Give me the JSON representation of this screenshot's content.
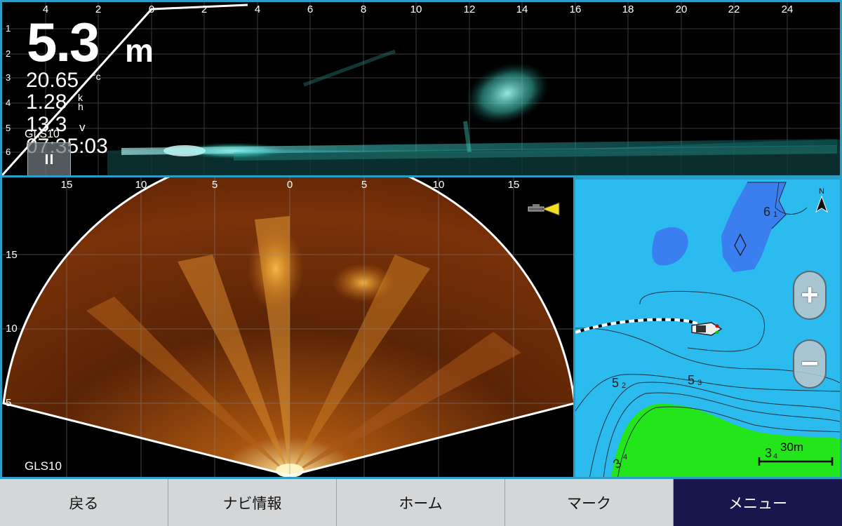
{
  "top_sonar": {
    "x_ticks": [
      "4",
      "2",
      "0",
      "2",
      "4",
      "6",
      "8",
      "10",
      "12",
      "14",
      "16",
      "18",
      "20",
      "22",
      "24"
    ],
    "y_ticks": [
      "1",
      "2",
      "3",
      "4",
      "5",
      "6"
    ],
    "depth_value": "5.3",
    "depth_unit": "m",
    "temperature_value": "20.65",
    "temperature_unit": "°c",
    "speed_value": "1.28",
    "speed_unit": "kh",
    "voltage_value": "13.3",
    "voltage_unit": "v",
    "time": "07:35:03",
    "source_label": "GLS10",
    "pause_icon": "pause-icon"
  },
  "fan_sonar": {
    "x_ticks": [
      "15",
      "10",
      "5",
      "0",
      "5",
      "10",
      "15"
    ],
    "y_ticks": [
      "15",
      "10",
      "5"
    ],
    "source_label": "GLS10",
    "transducer_icon": "transducer-direction-icon"
  },
  "map": {
    "zoom_in_label": "+",
    "zoom_out_label": "−",
    "north_label": "N",
    "scale_label": "30m",
    "depth_labels": [
      {
        "main": "6",
        "sub": "1"
      },
      {
        "main": "5",
        "sub": "2"
      },
      {
        "main": "5",
        "sub": "3"
      },
      {
        "main": "3",
        "sub": "4"
      },
      {
        "main": "3",
        "sub": "4"
      }
    ],
    "colors": {
      "water": "#2bbbef",
      "deep": "#3a7ef0",
      "land": "#22e619"
    }
  },
  "nav": {
    "back": "戻る",
    "navi_info": "ナビ情報",
    "home": "ホーム",
    "mark": "マーク",
    "menu": "メニュー"
  }
}
